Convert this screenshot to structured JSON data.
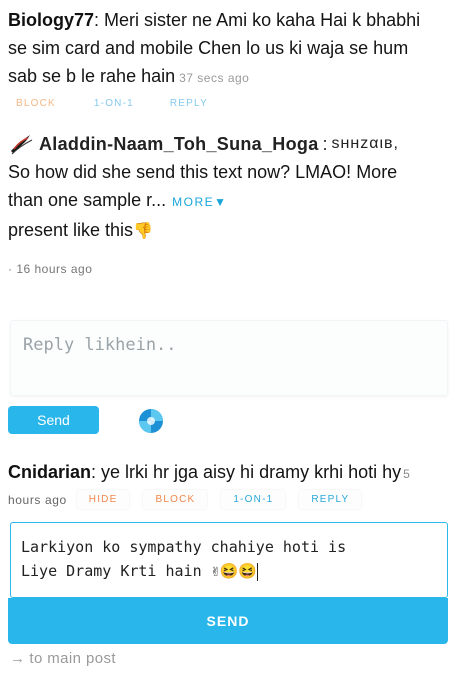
{
  "comment1": {
    "username": "Biology77",
    "text_line1": ": Meri sister ne Ami ko kaha Hai k bhabhi",
    "text_line2": "se sim card and mobile Chen lo us ki waja se hum",
    "text_line3": "sab se b le rahe hain",
    "time": "37 secs ago",
    "actions": [
      "BLOCK",
      "1-ON-1",
      "REPLY"
    ]
  },
  "comment2": {
    "username": "Aladdin-Naam_Toh_Suna_Hoga",
    "reply_to": "sʜʜzαιв,",
    "text_line1": "So how did she send this text now? LMAO! More",
    "text_line2": "than one sample r...",
    "more_label": "MORE",
    "text_line3": "present like this",
    "emoji": "👎",
    "time": "· 16 hours ago"
  },
  "reply_box1": {
    "placeholder": "Reply likhein..",
    "send_label": "Send"
  },
  "comment3": {
    "username": "Cnidarian",
    "text": ": ye lrki hr jga aisy hi dramy krhi hoti hy",
    "time_num": "5",
    "time_rest": "hours ago",
    "actions": [
      "HIDE",
      "BLOCK",
      "1-ON-1",
      "REPLY"
    ]
  },
  "reply_box2": {
    "value_line1": "Larkiyon ko sympathy chahiye hoti is",
    "value_line2": "Liye Dramy Krti hain ✌😆😆",
    "send_label": "SEND"
  },
  "footer": {
    "arrow": "→",
    "link": "to main post"
  },
  "colors": {
    "accent": "#29b6ea",
    "orange": "#f0874a"
  }
}
